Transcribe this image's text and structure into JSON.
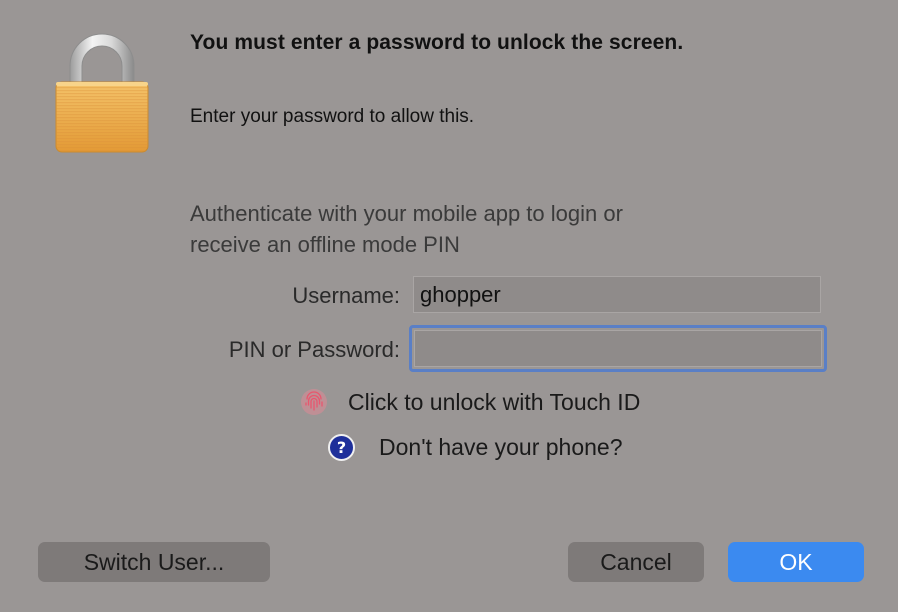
{
  "dialog": {
    "title": "You must enter a password to unlock the screen.",
    "subtitle": "Enter your password to allow this.",
    "auth_message_line1": "Authenticate with your mobile app to login or",
    "auth_message_line2": "receive an offline mode PIN",
    "icon": "padlock-icon"
  },
  "form": {
    "username_label": "Username:",
    "username_value": "ghopper",
    "pin_label": "PIN or Password:",
    "pin_value": ""
  },
  "links": {
    "touch_id": "Click to unlock with Touch ID",
    "touch_id_icon": "fingerprint-icon",
    "no_phone": "Don't have your phone?",
    "no_phone_icon": "question-mark-icon"
  },
  "buttons": {
    "switch_user": "Switch User...",
    "cancel": "Cancel",
    "ok": "OK"
  },
  "colors": {
    "background": "#9a9695",
    "accent": "#3b8af0",
    "focus_ring": "#5a7fc6",
    "help_icon": "#1e2f9a",
    "lock_body": "#e9a84a"
  }
}
